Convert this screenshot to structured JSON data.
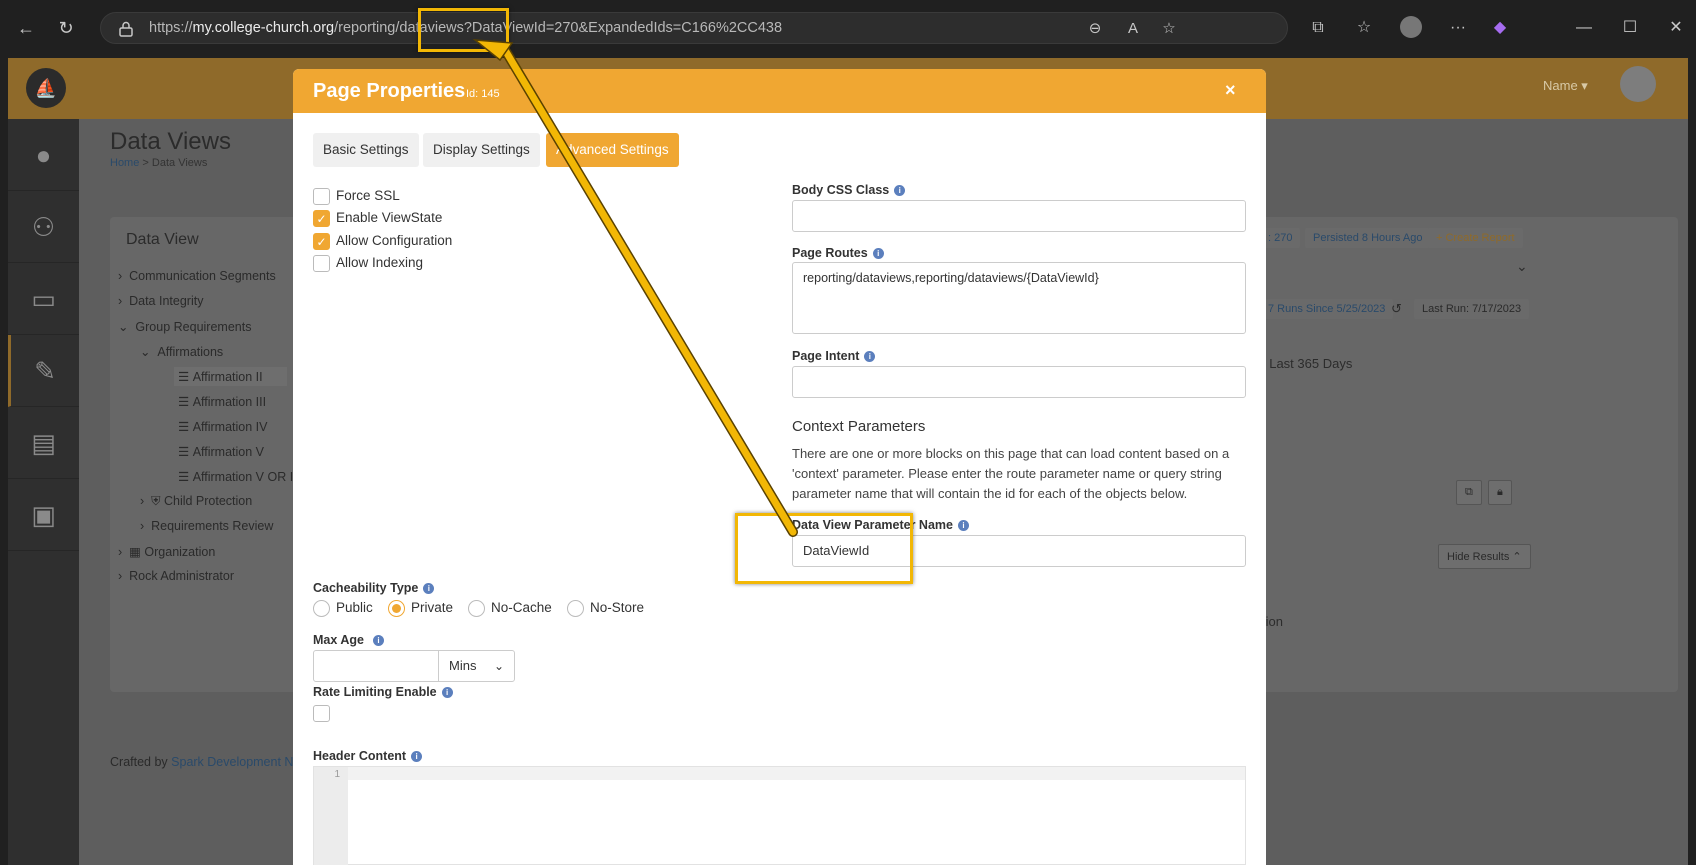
{
  "browser": {
    "url_prefix": "https://",
    "url_domain": "my.college-church.org",
    "url_path": "/reporting/dataviews?DataViewId=270&ExpandedIds=C166%2CC438"
  },
  "app": {
    "header_user": "Name ▾",
    "page_title": "Data Views",
    "breadcrumb_home": "Home",
    "breadcrumb_sep": ">",
    "breadcrumb_current": "Data Views",
    "panel_title": "Data View",
    "tree": [
      {
        "label": "Communication Segments"
      },
      {
        "label": "Data Integrity"
      },
      {
        "label": "Group Requirements"
      },
      {
        "label": "Affirmations"
      },
      {
        "label": "Affirmation II"
      },
      {
        "label": "Affirmation III"
      },
      {
        "label": "Affirmation IV"
      },
      {
        "label": "Affirmation V"
      },
      {
        "label": "Affirmation V OR IV"
      },
      {
        "label": "Child Protection"
      },
      {
        "label": "Requirements Review"
      },
      {
        "label": "Organization"
      },
      {
        "label": "Rock Administrator"
      }
    ],
    "bg": {
      "id_chip": ": 270",
      "persisted_chip": "Persisted 8 Hours Ago",
      "create_report": "+ Create Report",
      "runs_chip": "7 Runs Since 5/25/2023",
      "last_run": "Last Run: 7/17/2023",
      "last_days": ": Last 365 Days",
      "hide_results": "Hide Results ⌃",
      "tion_text": "tion"
    },
    "footer_prefix": "Crafted by",
    "footer_link": "Spark Development Network"
  },
  "modal": {
    "title": "Page Properties",
    "id_label": "Id: 145",
    "close": "×",
    "tabs": [
      {
        "label": "Basic Settings",
        "active": false
      },
      {
        "label": "Display Settings",
        "active": false
      },
      {
        "label": "Advanced Settings",
        "active": true
      }
    ],
    "checkboxes": [
      {
        "label": "Force SSL",
        "checked": false
      },
      {
        "label": "Enable ViewState",
        "checked": true
      },
      {
        "label": "Allow Configuration",
        "checked": true
      },
      {
        "label": "Allow Indexing",
        "checked": false
      }
    ],
    "body_css_label": "Body CSS Class",
    "body_css_value": "",
    "page_routes_label": "Page Routes",
    "page_routes_value": "reporting/dataviews,reporting/dataviews/{DataViewId}",
    "page_intent_label": "Page Intent",
    "page_intent_value": "",
    "context_title": "Context Parameters",
    "context_desc": "There are one or more blocks on this page that can load content based on a 'context' parameter. Please enter the route parameter name or query string parameter name that will contain the id for each of the objects below.",
    "dv_param_label": "Data View Parameter Name",
    "dv_param_value": "DataViewId",
    "cacheability_label": "Cacheability Type",
    "cacheability_options": [
      {
        "label": "Public",
        "checked": false
      },
      {
        "label": "Private",
        "checked": true
      },
      {
        "label": "No-Cache",
        "checked": false
      },
      {
        "label": "No-Store",
        "checked": false
      }
    ],
    "max_age_label": "Max Age",
    "max_age_value": "",
    "max_age_unit": "Mins",
    "rate_limit_label": "Rate Limiting Enable",
    "rate_limit_checked": false,
    "header_content_label": "Header Content",
    "code_line_number": "1"
  },
  "colors": {
    "accent": "#f0a732",
    "annotation": "#f2b705",
    "info": "#5b7fbd"
  }
}
